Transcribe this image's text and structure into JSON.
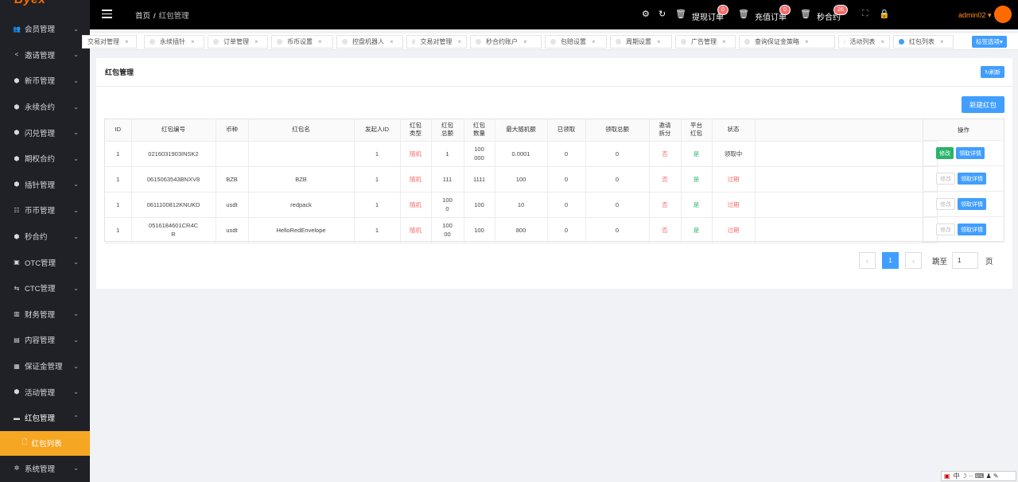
{
  "logo": "Byex",
  "sidebar": {
    "items": [
      {
        "label": "会员管理",
        "icon": "users-icon",
        "glyph": "👥"
      },
      {
        "label": "邀请管理",
        "icon": "share-icon",
        "glyph": "<"
      },
      {
        "label": "新币管理",
        "icon": "cube-icon",
        "glyph": "⬢"
      },
      {
        "label": "永续合约",
        "icon": "cube-icon",
        "glyph": "⬢"
      },
      {
        "label": "闪兑管理",
        "icon": "cube-icon",
        "glyph": "⬢"
      },
      {
        "label": "期权合约",
        "icon": "cube-icon",
        "glyph": "⬢"
      },
      {
        "label": "插针管理",
        "icon": "cube-icon",
        "glyph": "⬢"
      },
      {
        "label": "币币管理",
        "icon": "sliders-icon",
        "glyph": "☷"
      },
      {
        "label": "秒合约",
        "icon": "cube-icon",
        "glyph": "⬢"
      },
      {
        "label": "OTC管理",
        "icon": "briefcase-icon",
        "glyph": "▣"
      },
      {
        "label": "CTC管理",
        "icon": "exchange-icon",
        "glyph": "⇆"
      },
      {
        "label": "财务管理",
        "icon": "bar-chart-icon",
        "glyph": "▥"
      },
      {
        "label": "内容管理",
        "icon": "inbox-icon",
        "glyph": "▤"
      },
      {
        "label": "保证金管理",
        "icon": "keyboard-icon",
        "glyph": "▦"
      },
      {
        "label": "活动管理",
        "icon": "cube-icon",
        "glyph": "⬢"
      },
      {
        "label": "红包管理",
        "icon": "folder-icon",
        "glyph": "▬"
      }
    ],
    "sub_item": "红包列表",
    "last_item": {
      "label": "系统管理",
      "icon": "gear-icon",
      "glyph": "✲"
    }
  },
  "topbar": {
    "breadcrumb_home": "首页",
    "breadcrumb_sep": "/",
    "breadcrumb_current": "红包管理",
    "withdraw_label": "提现订单",
    "withdraw_count": "0",
    "deposit_label": "充值订单",
    "deposit_count": "0",
    "second_contract_label": "秒合约",
    "second_contract_count": "26",
    "user": "admin02 ▾"
  },
  "tabs": [
    {
      "label": "交易对管理"
    },
    {
      "label": "永续插针"
    },
    {
      "label": "订单管理"
    },
    {
      "label": "币币设置"
    },
    {
      "label": "控盘机器人"
    },
    {
      "label": "交易对管理"
    },
    {
      "label": "秒合约账户"
    },
    {
      "label": "包赔设置"
    },
    {
      "label": "周期设置"
    },
    {
      "label": "广告管理"
    },
    {
      "label": "查询保证金策略"
    },
    {
      "label": "活动列表"
    },
    {
      "label": "红包列表"
    }
  ],
  "tab_options": "标签选项▾",
  "panel": {
    "title": "红包管理",
    "refresh": "↻刷新",
    "new_button": "新建红包"
  },
  "table": {
    "headers": [
      "ID",
      "红包编号",
      "币种",
      "红包名",
      "发起人ID",
      "红包\n类型",
      "红包\n总额",
      "红包\n数量",
      "最大随机额",
      "已领取",
      "领取总额",
      "邀请\n拆分",
      "平台\n红包",
      "状态"
    ],
    "ops_header": "操作",
    "edit_label": "修改",
    "detail_label": "领取详情",
    "rows": [
      [
        "1",
        "0216031903INSK2",
        "",
        "",
        "1",
        "随机",
        "1",
        "100\n000",
        "0.0001",
        "0",
        "0",
        "否",
        "是",
        "领取中"
      ],
      [
        "1",
        "0615063543BNXV8",
        "BZB",
        "BZB",
        "1",
        "随机",
        "111",
        "1111",
        "100",
        "0",
        "0",
        "否",
        "是",
        "过期"
      ],
      [
        "1",
        "0611100812KNUKD",
        "usdt",
        "redpack",
        "1",
        "随机",
        "100\n0",
        "100",
        "10",
        "0",
        "0",
        "否",
        "是",
        "过期"
      ],
      [
        "1",
        "0516184601CR4C\nR",
        "usdt",
        "HelloRedEnvelope",
        "1",
        "随机",
        "100\n00",
        "100",
        "800",
        "0",
        "0",
        "否",
        "是",
        "过期"
      ]
    ],
    "edit_enabled": [
      true,
      false,
      false,
      false
    ]
  },
  "pager": {
    "prev": "‹",
    "current": "1",
    "next": "›",
    "goto_label": "跳至",
    "goto_value": "1",
    "page_label": "页"
  },
  "ime": "中 ☽ ·· ⌨ ♟ ✎"
}
